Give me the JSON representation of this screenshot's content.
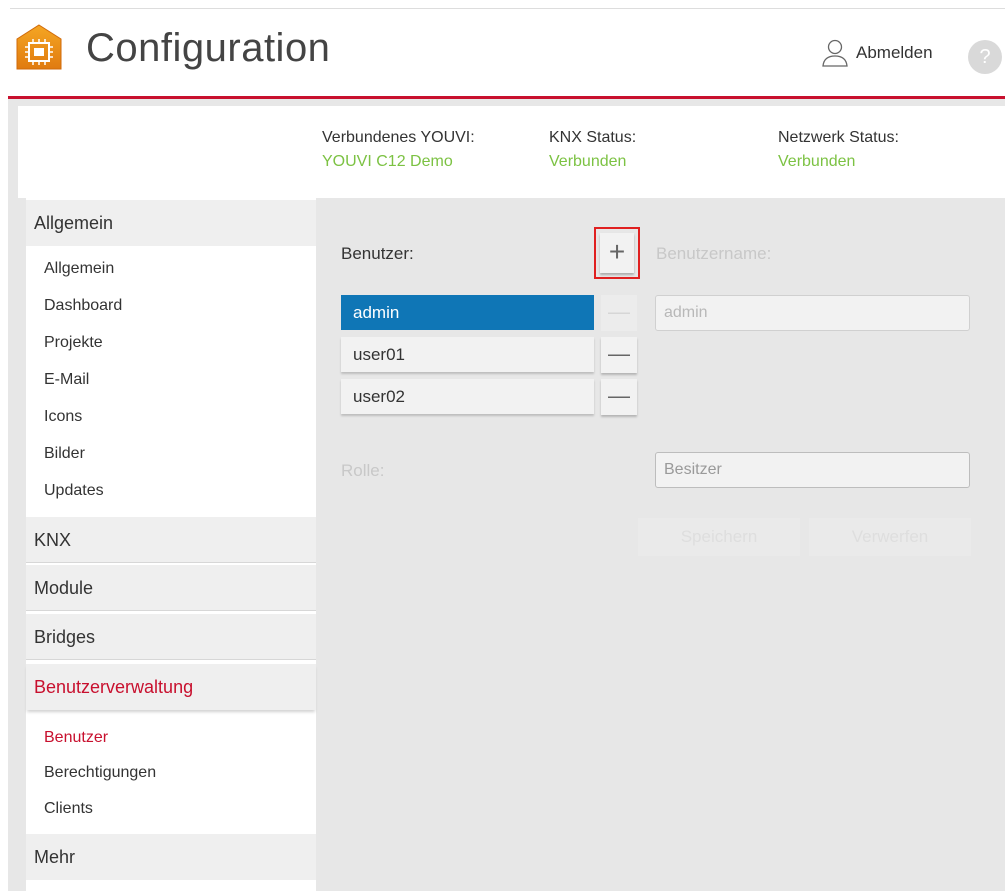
{
  "header": {
    "title": "Configuration",
    "logout_label": "Abmelden",
    "help_label": "?",
    "brand_color": "#c8102e"
  },
  "status": {
    "youvi_label": "Verbundenes YOUVI:",
    "youvi_value": "YOUVI C12 Demo",
    "knx_label": "KNX Status:",
    "knx_value": "Verbunden",
    "network_label": "Netzwerk Status:",
    "network_value": "Verbunden",
    "ok_color": "#7cc243"
  },
  "sidebar": {
    "sections": [
      {
        "label": "Allgemein",
        "items": [
          "Allgemein",
          "Dashboard",
          "Projekte",
          "E-Mail",
          "Icons",
          "Bilder",
          "Updates"
        ]
      },
      {
        "label": "KNX"
      },
      {
        "label": "Module"
      },
      {
        "label": "Bridges"
      },
      {
        "label": "Benutzerverwaltung",
        "items": [
          "Benutzer",
          "Berechtigungen",
          "Clients"
        ]
      },
      {
        "label": "Mehr"
      }
    ],
    "active_section": "Benutzerverwaltung",
    "active_item": "Benutzer"
  },
  "main": {
    "users_label": "Benutzer:",
    "add_icon": "+",
    "remove_icon": "—",
    "users": [
      "admin",
      "user01",
      "user02"
    ],
    "selected_user": "admin",
    "username_label": "Benutzername:",
    "username_value": "admin",
    "role_label": "Rolle:",
    "role_value": "Besitzer",
    "save_label": "Speichern",
    "discard_label": "Verwerfen",
    "selected_color": "#0f76b6"
  }
}
